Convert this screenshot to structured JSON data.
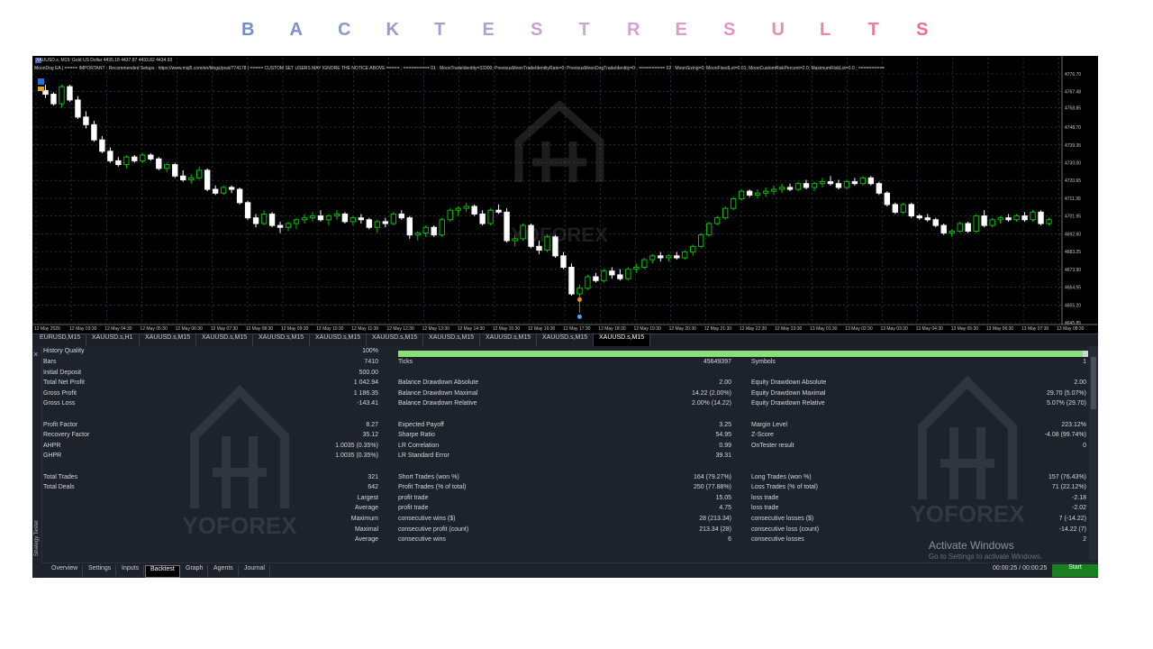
{
  "banner": {
    "letters": [
      {
        "ch": "B",
        "color": "#6f8fc8"
      },
      {
        "ch": "A",
        "color": "#7e93cd"
      },
      {
        "ch": "C",
        "color": "#8a98cf"
      },
      {
        "ch": "K",
        "color": "#979ad1"
      },
      {
        "ch": "T",
        "color": "#a69dd3"
      },
      {
        "ch": "E",
        "color": "#b6a0d3"
      },
      {
        "ch": "S",
        "color": "#c2a2d3"
      },
      {
        "ch": "T",
        "color": "#d0a4d2"
      },
      {
        "ch": "R",
        "color": "#d8a0cc"
      },
      {
        "ch": "E",
        "color": "#de9cc6"
      },
      {
        "ch": "S",
        "color": "#e294bd"
      },
      {
        "ch": "U",
        "color": "#e68db2"
      },
      {
        "ch": "L",
        "color": "#e985a8"
      },
      {
        "ch": "T",
        "color": "#ec7d9d"
      },
      {
        "ch": "S",
        "color": "#ef6f8e"
      }
    ]
  },
  "chart": {
    "header_line1": "XAUUSD.s, M15:  Gold US Dollar  4435.18 4437.87 4433.82 4434.93",
    "header_line2": "MoonDog EA | ===== IMPORTANT : Recommended Setups : https://www.mql5.com/en/blogs/post/774178 | ===== CUSTOM SET USERS MAY IGNORE THE NOTICE ABOVE ===== ; ========== 01 : MoonTradeIdentity=33300; PreviousMoonTradeIdentityRate=0; PreviousMoonDogTradeIdentity=0 ; ========== 02 : MoonSizing=0; MoonFixedLot=0.01; MoonCustomRiskPercent=2.0; MaximumRiskLot=0.0 ; ==========",
    "price_labels": [
      "4776.70",
      "4767.48",
      "4758.85",
      "4748.70",
      "4739.35",
      "4730.00",
      "4720.65",
      "4711.30",
      "4701.95",
      "4692.60",
      "4683.25",
      "4673.90",
      "4664.55",
      "4655.20",
      "4645.85"
    ],
    "time_labels": [
      "12 May 2026",
      "12 May 03:30",
      "12 May 04:30",
      "12 May 05:30",
      "12 May 06:30",
      "12 May 07:30",
      "12 May 08:30",
      "12 May 09:30",
      "12 May 10:30",
      "12 May 11:30",
      "12 May 12:30",
      "12 May 13:30",
      "12 May 14:30",
      "12 May 15:30",
      "12 May 16:30",
      "12 May 17:30",
      "12 May 18:30",
      "12 May 19:30",
      "12 May 20:30",
      "12 May 21:30",
      "12 May 22:30",
      "12 May 23:30",
      "13 May 01:30",
      "13 May 02:30",
      "13 May 03:30",
      "13 May 04:30",
      "13 May 05:30",
      "13 May 06:30",
      "13 May 07:30",
      "13 May 08:30"
    ],
    "watermark": "YOFOREX",
    "colors": {
      "background": "#000000",
      "bull": "#00c000",
      "bear": "#ffffff",
      "grid": "#3b4a5a",
      "axis_text": "#c8c8c8"
    }
  },
  "chart_data": {
    "type": "candlestick",
    "symbol": "XAUUSD.s",
    "timeframe": "M15",
    "ylim": [
      4645.85,
      4776.7
    ],
    "candles": [
      [
        4768,
        4771,
        4764,
        4766
      ],
      [
        4766,
        4767,
        4760,
        4761
      ],
      [
        4761,
        4771,
        4759,
        4770
      ],
      [
        4770,
        4771,
        4762,
        4763
      ],
      [
        4763,
        4765,
        4753,
        4754
      ],
      [
        4754,
        4757,
        4748,
        4750
      ],
      [
        4750,
        4752,
        4741,
        4742
      ],
      [
        4742,
        4744,
        4735,
        4736
      ],
      [
        4736,
        4738,
        4730,
        4731
      ],
      [
        4731,
        4733,
        4728,
        4729
      ],
      [
        4729,
        4734,
        4727,
        4733
      ],
      [
        4733,
        4734,
        4730,
        4731
      ],
      [
        4731,
        4735,
        4730,
        4734
      ],
      [
        4734,
        4735,
        4731,
        4732
      ],
      [
        4732,
        4733,
        4726,
        4727
      ],
      [
        4727,
        4730,
        4725,
        4729
      ],
      [
        4729,
        4730,
        4722,
        4723
      ],
      [
        4723,
        4726,
        4720,
        4721
      ],
      [
        4721,
        4724,
        4719,
        4722
      ],
      [
        4722,
        4728,
        4721,
        4726
      ],
      [
        4726,
        4727,
        4715,
        4716
      ],
      [
        4716,
        4718,
        4713,
        4714
      ],
      [
        4714,
        4718,
        4713,
        4717
      ],
      [
        4717,
        4718,
        4714,
        4716
      ],
      [
        4716,
        4717,
        4708,
        4709
      ],
      [
        4709,
        4710,
        4700,
        4701
      ],
      [
        4701,
        4703,
        4696,
        4698
      ],
      [
        4698,
        4705,
        4697,
        4703
      ],
      [
        4703,
        4704,
        4696,
        4697
      ],
      [
        4697,
        4699,
        4693,
        4696
      ],
      [
        4696,
        4699,
        4694,
        4698
      ],
      [
        4698,
        4701,
        4695,
        4700
      ],
      [
        4700,
        4703,
        4698,
        4701
      ],
      [
        4701,
        4704,
        4699,
        4702
      ],
      [
        4702,
        4705,
        4699,
        4700
      ],
      [
        4700,
        4703,
        4697,
        4702
      ],
      [
        4702,
        4705,
        4700,
        4703
      ],
      [
        4703,
        4704,
        4698,
        4699
      ],
      [
        4699,
        4702,
        4697,
        4701
      ],
      [
        4701,
        4703,
        4698,
        4700
      ],
      [
        4700,
        4701,
        4695,
        4696
      ],
      [
        4696,
        4700,
        4693,
        4699
      ],
      [
        4699,
        4701,
        4696,
        4698
      ],
      [
        4698,
        4704,
        4697,
        4703
      ],
      [
        4703,
        4705,
        4700,
        4701
      ],
      [
        4701,
        4702,
        4690,
        4692
      ],
      [
        4692,
        4694,
        4689,
        4693
      ],
      [
        4693,
        4697,
        4691,
        4696
      ],
      [
        4696,
        4697,
        4691,
        4692
      ],
      [
        4692,
        4701,
        4691,
        4700
      ],
      [
        4700,
        4706,
        4699,
        4705
      ],
      [
        4705,
        4707,
        4702,
        4706
      ],
      [
        4706,
        4709,
        4704,
        4707
      ],
      [
        4707,
        4708,
        4702,
        4703
      ],
      [
        4703,
        4705,
        4697,
        4698
      ],
      [
        4698,
        4706,
        4697,
        4705
      ],
      [
        4705,
        4708,
        4703,
        4704
      ],
      [
        4704,
        4706,
        4688,
        4689
      ],
      [
        4689,
        4692,
        4686,
        4690
      ],
      [
        4690,
        4698,
        4689,
        4697
      ],
      [
        4697,
        4698,
        4685,
        4686
      ],
      [
        4686,
        4689,
        4682,
        4684
      ],
      [
        4684,
        4692,
        4683,
        4691
      ],
      [
        4691,
        4692,
        4680,
        4681
      ],
      [
        4681,
        4683,
        4674,
        4675
      ],
      [
        4675,
        4677,
        4660,
        4661
      ],
      [
        4661,
        4666,
        4651,
        4664
      ],
      [
        4664,
        4671,
        4663,
        4670
      ],
      [
        4670,
        4672,
        4667,
        4668
      ],
      [
        4668,
        4674,
        4667,
        4673
      ],
      [
        4673,
        4675,
        4669,
        4671
      ],
      [
        4671,
        4674,
        4668,
        4669
      ],
      [
        4669,
        4675,
        4668,
        4674
      ],
      [
        4674,
        4677,
        4672,
        4675
      ],
      [
        4675,
        4680,
        4674,
        4679
      ],
      [
        4679,
        4682,
        4677,
        4681
      ],
      [
        4681,
        4683,
        4678,
        4680
      ],
      [
        4680,
        4682,
        4678,
        4681
      ],
      [
        4681,
        4683,
        4679,
        4680
      ],
      [
        4680,
        4684,
        4679,
        4683
      ],
      [
        4683,
        4687,
        4681,
        4686
      ],
      [
        4686,
        4693,
        4685,
        4692
      ],
      [
        4692,
        4699,
        4691,
        4698
      ],
      [
        4698,
        4702,
        4697,
        4701
      ],
      [
        4701,
        4707,
        4700,
        4706
      ],
      [
        4706,
        4712,
        4705,
        4711
      ],
      [
        4711,
        4716,
        4710,
        4715
      ],
      [
        4715,
        4716,
        4712,
        4713
      ],
      [
        4713,
        4716,
        4711,
        4714
      ],
      [
        4714,
        4717,
        4712,
        4715
      ],
      [
        4715,
        4718,
        4713,
        4716
      ],
      [
        4716,
        4719,
        4714,
        4717
      ],
      [
        4717,
        4719,
        4715,
        4716
      ],
      [
        4716,
        4720,
        4715,
        4719
      ],
      [
        4719,
        4721,
        4716,
        4717
      ],
      [
        4717,
        4720,
        4715,
        4719
      ],
      [
        4719,
        4722,
        4717,
        4720
      ],
      [
        4720,
        4723,
        4718,
        4719
      ],
      [
        4719,
        4721,
        4716,
        4717
      ],
      [
        4717,
        4721,
        4716,
        4720
      ],
      [
        4720,
        4722,
        4718,
        4719
      ],
      [
        4719,
        4723,
        4718,
        4722
      ],
      [
        4722,
        4723,
        4718,
        4719
      ],
      [
        4719,
        4720,
        4713,
        4714
      ],
      [
        4714,
        4715,
        4707,
        4708
      ],
      [
        4708,
        4709,
        4703,
        4704
      ],
      [
        4704,
        4709,
        4703,
        4708
      ],
      [
        4708,
        4709,
        4701,
        4702
      ],
      [
        4702,
        4703,
        4700,
        4701
      ],
      [
        4701,
        4703,
        4699,
        4700
      ],
      [
        4700,
        4701,
        4696,
        4697
      ],
      [
        4697,
        4698,
        4692,
        4693
      ],
      [
        4693,
        4695,
        4691,
        4694
      ],
      [
        4694,
        4699,
        4693,
        4698
      ],
      [
        4698,
        4699,
        4693,
        4694
      ],
      [
        4694,
        4703,
        4693,
        4702
      ],
      [
        4702,
        4705,
        4696,
        4697
      ],
      [
        4697,
        4701,
        4696,
        4700
      ],
      [
        4700,
        4702,
        4698,
        4701
      ],
      [
        4701,
        4703,
        4699,
        4700
      ],
      [
        4700,
        4703,
        4699,
        4702
      ],
      [
        4702,
        4704,
        4699,
        4700
      ],
      [
        4700,
        4705,
        4699,
        4704
      ],
      [
        4704,
        4705,
        4697,
        4698
      ],
      [
        4698,
        4701,
        4697,
        4700
      ]
    ],
    "trade_markers": [
      {
        "price": 4658,
        "side": "sell",
        "color": "#ff8800"
      },
      {
        "price": 4649,
        "side": "buy",
        "color": "#4aa3ff"
      }
    ]
  },
  "symbol_tabs": [
    "EURUSD,M15",
    "XAUUSD.s,H1",
    "XAUUSD.s,M15",
    "XAUUSD.s,M15",
    "XAUUSD.s,M15",
    "XAUUSD.s,M15",
    "XAUUSD.s,M15",
    "XAUUSD.s,M15",
    "XAUUSD.s,M15",
    "XAUUSD.s,M15",
    "XAUUSD.s,M15"
  ],
  "tester": {
    "side_label": "Strategy Tester",
    "history_quality": {
      "label": "History Quality",
      "value": "100%",
      "fraction": 1.0
    },
    "rows": [
      {
        "c1l": "Bars",
        "c1v": "7410",
        "c2l": "Ticks",
        "c2v": "45649397",
        "c3l": "Symbols",
        "c3v": "1"
      },
      {
        "c1l": "Initial Deposit",
        "c1v": "500.00",
        "c2l": "",
        "c2v": "",
        "c3l": "",
        "c3v": ""
      },
      {
        "c1l": "Total Net Profit",
        "c1v": "1 042.94",
        "c2l": "Balance Drawdown Absolute",
        "c2v": "2.00",
        "c3l": "Equity Drawdown Absolute",
        "c3v": "2.00"
      },
      {
        "c1l": "Gross Profit",
        "c1v": "1 186.35",
        "c2l": "Balance Drawdown Maximal",
        "c2v": "14.22 (2.00%)",
        "c3l": "Equity Drawdown Maximal",
        "c3v": "29.70 (5.07%)"
      },
      {
        "c1l": "Gross Loss",
        "c1v": "-143.41",
        "c2l": "Balance Drawdown Relative",
        "c2v": "2.00% (14.22)",
        "c3l": "Equity Drawdown Relative",
        "c3v": "5.07% (29.70)"
      },
      {
        "c1l": "",
        "c1v": "",
        "c2l": "",
        "c2v": "",
        "c3l": "",
        "c3v": ""
      },
      {
        "c1l": "Profit Factor",
        "c1v": "8.27",
        "c2l": "Expected Payoff",
        "c2v": "3.25",
        "c3l": "Margin Level",
        "c3v": "223.12%"
      },
      {
        "c1l": "Recovery Factor",
        "c1v": "35.12",
        "c2l": "Sharpe Ratio",
        "c2v": "54.95",
        "c3l": "Z-Score",
        "c3v": "-4.08 (99.74%)"
      },
      {
        "c1l": "AHPR",
        "c1v": "1.0035 (0.35%)",
        "c2l": "LR Correlation",
        "c2v": "0.99",
        "c3l": "OnTester result",
        "c3v": "0"
      },
      {
        "c1l": "GHPR",
        "c1v": "1.0035 (0.35%)",
        "c2l": "LR Standard Error",
        "c2v": "39.31",
        "c3l": "",
        "c3v": ""
      },
      {
        "c1l": "",
        "c1v": "",
        "c2l": "",
        "c2v": "",
        "c3l": "",
        "c3v": ""
      },
      {
        "c1l": "Total Trades",
        "c1v": "321",
        "c2l": "Short Trades (won %)",
        "c2v": "164 (79.27%)",
        "c3l": "Long Trades (won %)",
        "c3v": "157 (76.43%)"
      },
      {
        "c1l": "Total Deals",
        "c1v": "642",
        "c2l": "Profit Trades (% of total)",
        "c2v": "250 (77.88%)",
        "c3l": "Loss Trades (% of total)",
        "c3v": "71 (22.12%)"
      },
      {
        "c1r": "Largest",
        "c2l": "profit trade",
        "c2v": "15.05",
        "c3l": "loss trade",
        "c3v": "-2.18"
      },
      {
        "c1r": "Average",
        "c2l": "profit trade",
        "c2v": "4.75",
        "c3l": "loss trade",
        "c3v": "-2.02"
      },
      {
        "c1r": "Maximum",
        "c2l": "consecutive wins ($)",
        "c2v": "28 (213.34)",
        "c3l": "consecutive losses ($)",
        "c3v": "7 (-14.22)"
      },
      {
        "c1r": "Maximal",
        "c2l": "consecutive profit (count)",
        "c2v": "213.34 (28)",
        "c3l": "consecutive loss (count)",
        "c3v": "-14.22 (7)"
      },
      {
        "c1r": "Average",
        "c2l": "consecutive wins",
        "c2v": "6",
        "c3l": "consecutive losses",
        "c3v": "2"
      }
    ],
    "bottom_tabs": [
      "Overview",
      "Settings",
      "Inputs",
      "Backtest",
      "Graph",
      "Agents",
      "Journal"
    ],
    "active_tab": "Backtest",
    "timer": "00:00:25 / 00:00:25",
    "start_label": "Start",
    "activate_title": "Activate Windows",
    "activate_sub": "Go to Settings to activate Windows.",
    "watermark": "YOFOREX"
  }
}
